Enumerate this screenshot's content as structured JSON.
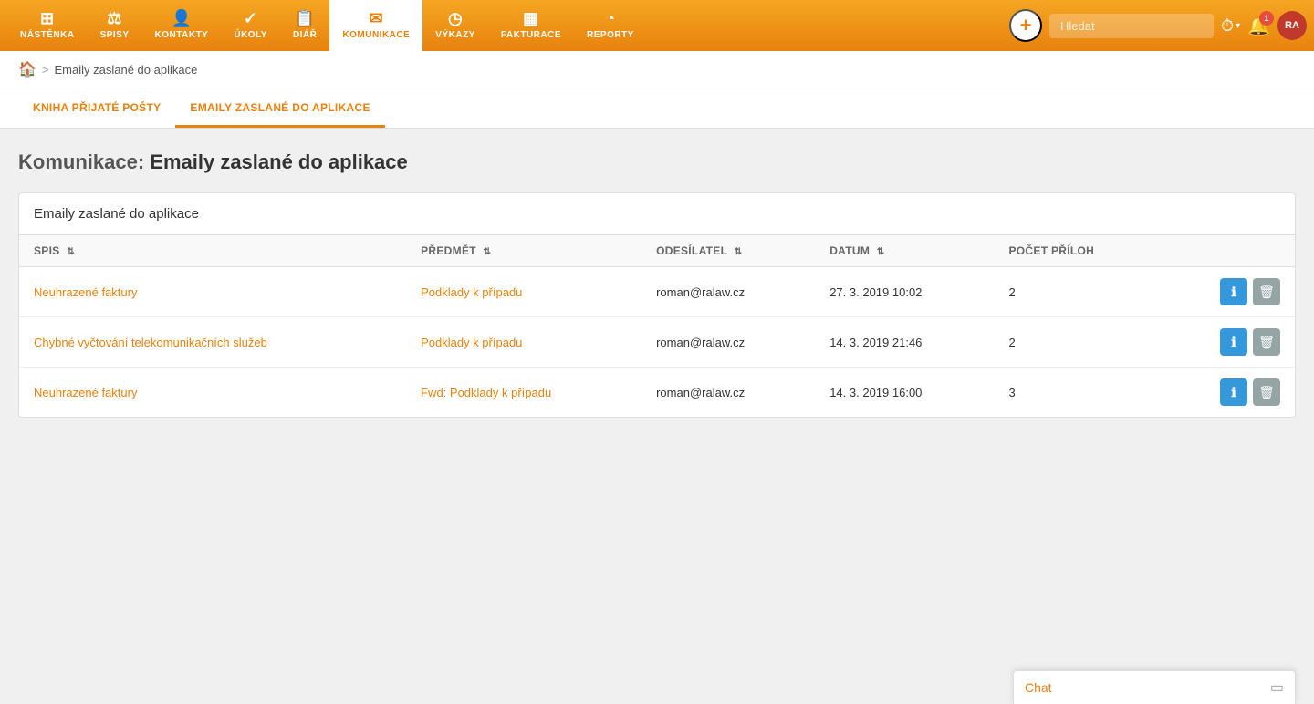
{
  "navbar": {
    "items": [
      {
        "id": "nastенка",
        "label": "NÁSTĚNKA",
        "icon": "⊞",
        "active": false
      },
      {
        "id": "spisy",
        "label": "SPISY",
        "icon": "⚖",
        "active": false
      },
      {
        "id": "kontakty",
        "label": "KONTAKTY",
        "icon": "👤",
        "active": false
      },
      {
        "id": "ukoly",
        "label": "ÚKOLY",
        "icon": "✓",
        "active": false
      },
      {
        "id": "diar",
        "label": "DIÁŘ",
        "icon": "📋",
        "active": false
      },
      {
        "id": "komunikace",
        "label": "KOMUNIKACE",
        "icon": "✉",
        "active": true
      },
      {
        "id": "vykazy",
        "label": "VÝKAZY",
        "icon": "◷",
        "active": false
      },
      {
        "id": "fakturace",
        "label": "FAKTURACE",
        "icon": "▦",
        "active": false
      },
      {
        "id": "reporty",
        "label": "REPORTY",
        "icon": "◔",
        "active": false
      }
    ],
    "search_placeholder": "Hledat",
    "add_button": "+",
    "bell_count": "1",
    "avatar_label": "RA"
  },
  "breadcrumb": {
    "home_icon": "🏠",
    "separator": ">",
    "current": "Emaily zaslané do aplikace"
  },
  "tabs": [
    {
      "id": "kniha",
      "label": "KNIHA PŘIJATÉ POŠTY",
      "active": false
    },
    {
      "id": "emaily",
      "label": "EMAILY ZASLANÉ DO APLIKACE",
      "active": true
    }
  ],
  "page": {
    "title_prefix": "Komunikace:",
    "title_main": "Emaily zaslané do aplikace"
  },
  "table": {
    "card_title": "Emaily zaslané do aplikace",
    "columns": [
      {
        "id": "spis",
        "label": "SPIS",
        "sortable": true
      },
      {
        "id": "predmet",
        "label": "PŘEDMĚT",
        "sortable": true
      },
      {
        "id": "odesilatel",
        "label": "ODESÍLATEL",
        "sortable": true
      },
      {
        "id": "datum",
        "label": "DATUM",
        "sortable": true
      },
      {
        "id": "prilohy",
        "label": "POČET PŘÍLOH",
        "sortable": false
      }
    ],
    "rows": [
      {
        "spis": "Neuhrazené faktury",
        "predmet": "Podklady k případu",
        "odesilatel": "roman@ralaw.cz",
        "datum": "27. 3. 2019 10:02",
        "prilohy": "2"
      },
      {
        "spis": "Chybné vyčtování telekomunikačních služeb",
        "predmet": "Podklady k případu",
        "odesilatel": "roman@ralaw.cz",
        "datum": "14. 3. 2019 21:46",
        "prilohy": "2"
      },
      {
        "spis": "Neuhrazené faktury",
        "predmet": "Fwd: Podklady k případu",
        "odesilatel": "roman@ralaw.cz",
        "datum": "14. 3. 2019 16:00",
        "prilohy": "3"
      }
    ],
    "btn_info_icon": "ℹ",
    "btn_delete_icon": "🗑"
  },
  "chat": {
    "label": "Chat",
    "minimize_icon": "▭"
  }
}
